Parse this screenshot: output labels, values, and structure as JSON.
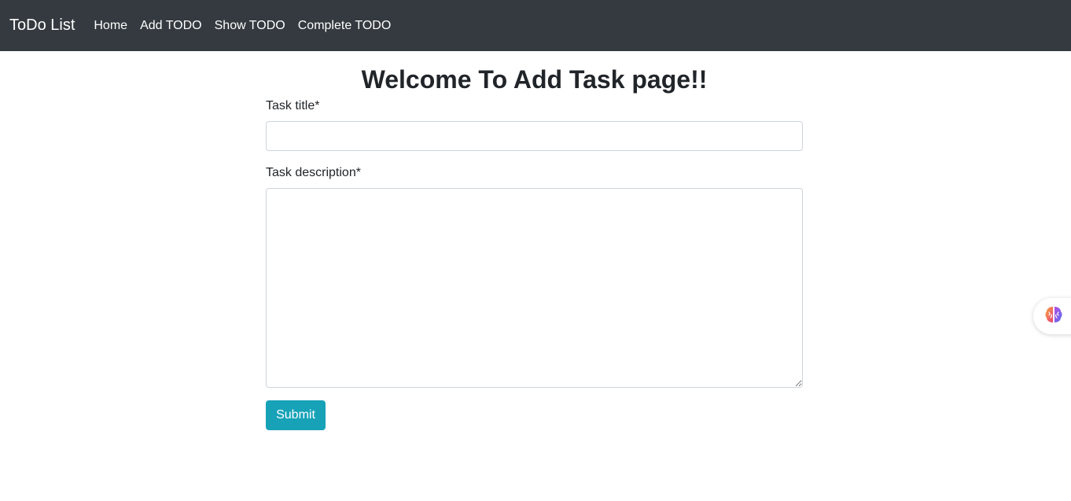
{
  "navbar": {
    "brand": "ToDo List",
    "links": [
      "Home",
      "Add TODO",
      "Show TODO",
      "Complete TODO"
    ],
    "background_color": "#343a40"
  },
  "main": {
    "title": "Welcome To Add Task page!!",
    "task_title_label": "Task title*",
    "task_title_value": "",
    "task_description_label": "Task description*",
    "task_description_value": "",
    "submit_label": "Submit",
    "submit_color": "#17a2b8"
  },
  "extension_widget": {
    "icon": "brain-icon"
  }
}
